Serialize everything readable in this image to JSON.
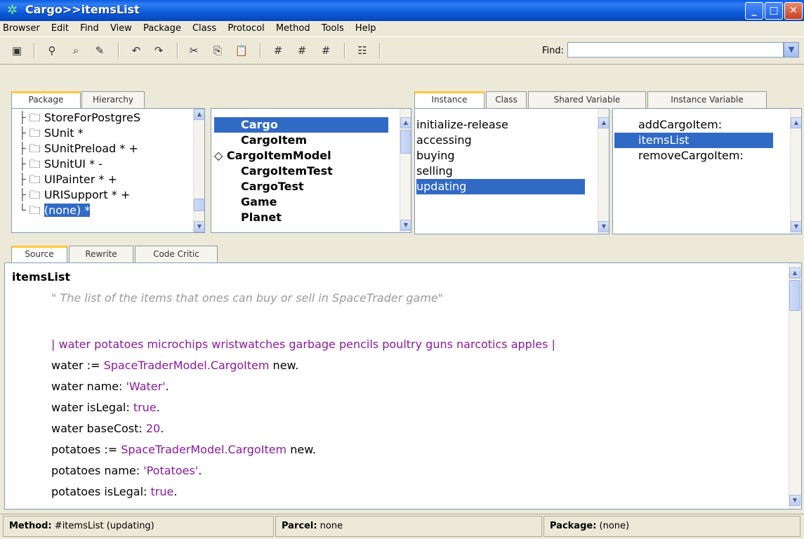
{
  "window": {
    "title": "Cargo>>itemsList"
  },
  "menu": [
    "Browser",
    "Edit",
    "Find",
    "View",
    "Package",
    "Class",
    "Protocol",
    "Method",
    "Tools",
    "Help"
  ],
  "toolbar": {
    "find_label": "Find:",
    "find_value": ""
  },
  "left_tabs": [
    "Package",
    "Hierarchy"
  ],
  "packages": [
    "StoreForPostgreS",
    "SUnit *",
    "SUnitPreload * +",
    "SUnitUI * -",
    "UIPainter * +",
    "URISupport * +",
    "(none) *"
  ],
  "classes": [
    "Cargo",
    "CargoItem",
    "CargoItemModel",
    "CargoItemTest",
    "CargoTest",
    "Game",
    "Planet"
  ],
  "right_tabs": [
    "Instance",
    "Class",
    "Shared Variable",
    "Instance Variable"
  ],
  "protocols": [
    "initialize-release",
    "accessing",
    "buying",
    "selling",
    "updating"
  ],
  "methods": [
    "addCargoItem:",
    "itemsList",
    "removeCargoItem:"
  ],
  "source_tabs": [
    "Source",
    "Rewrite",
    "Code Critic"
  ],
  "code": {
    "method_name": "itemsList",
    "comment": "\" The list of the items that ones can buy or sell in SpaceTrader game\"",
    "temps": "| water potatoes microchips wristwatches garbage pencils poultry guns narcotics apples |",
    "l1a": "water := ",
    "l1b": "SpaceTraderModel.CargoItem",
    "l1c": " new.",
    "l2a": "water name: ",
    "l2b": "'Water'",
    "l2c": ".",
    "l3a": "water isLegal: ",
    "l3b": "true",
    "l3c": ".",
    "l4a": "water baseCost: ",
    "l4b": "20",
    "l4c": ".",
    "l5a": "potatoes := ",
    "l5b": "SpaceTraderModel.CargoItem",
    "l5c": " new.",
    "l6a": "potatoes name: ",
    "l6b": "'Potatoes'",
    "l6c": ".",
    "l7a": "potatoes isLegal: ",
    "l7b": "true",
    "l7c": "."
  },
  "status": {
    "method_label": "Method:",
    "method_value": " #itemsList (updating)",
    "parcel_label": "Parcel:",
    "parcel_value": " none",
    "package_label": "Package:",
    "package_value": " (none)"
  },
  "colors": {
    "selection": "#316ac5",
    "code_literal": "#8a1a9c",
    "titlebar": "#0b5ad9"
  }
}
